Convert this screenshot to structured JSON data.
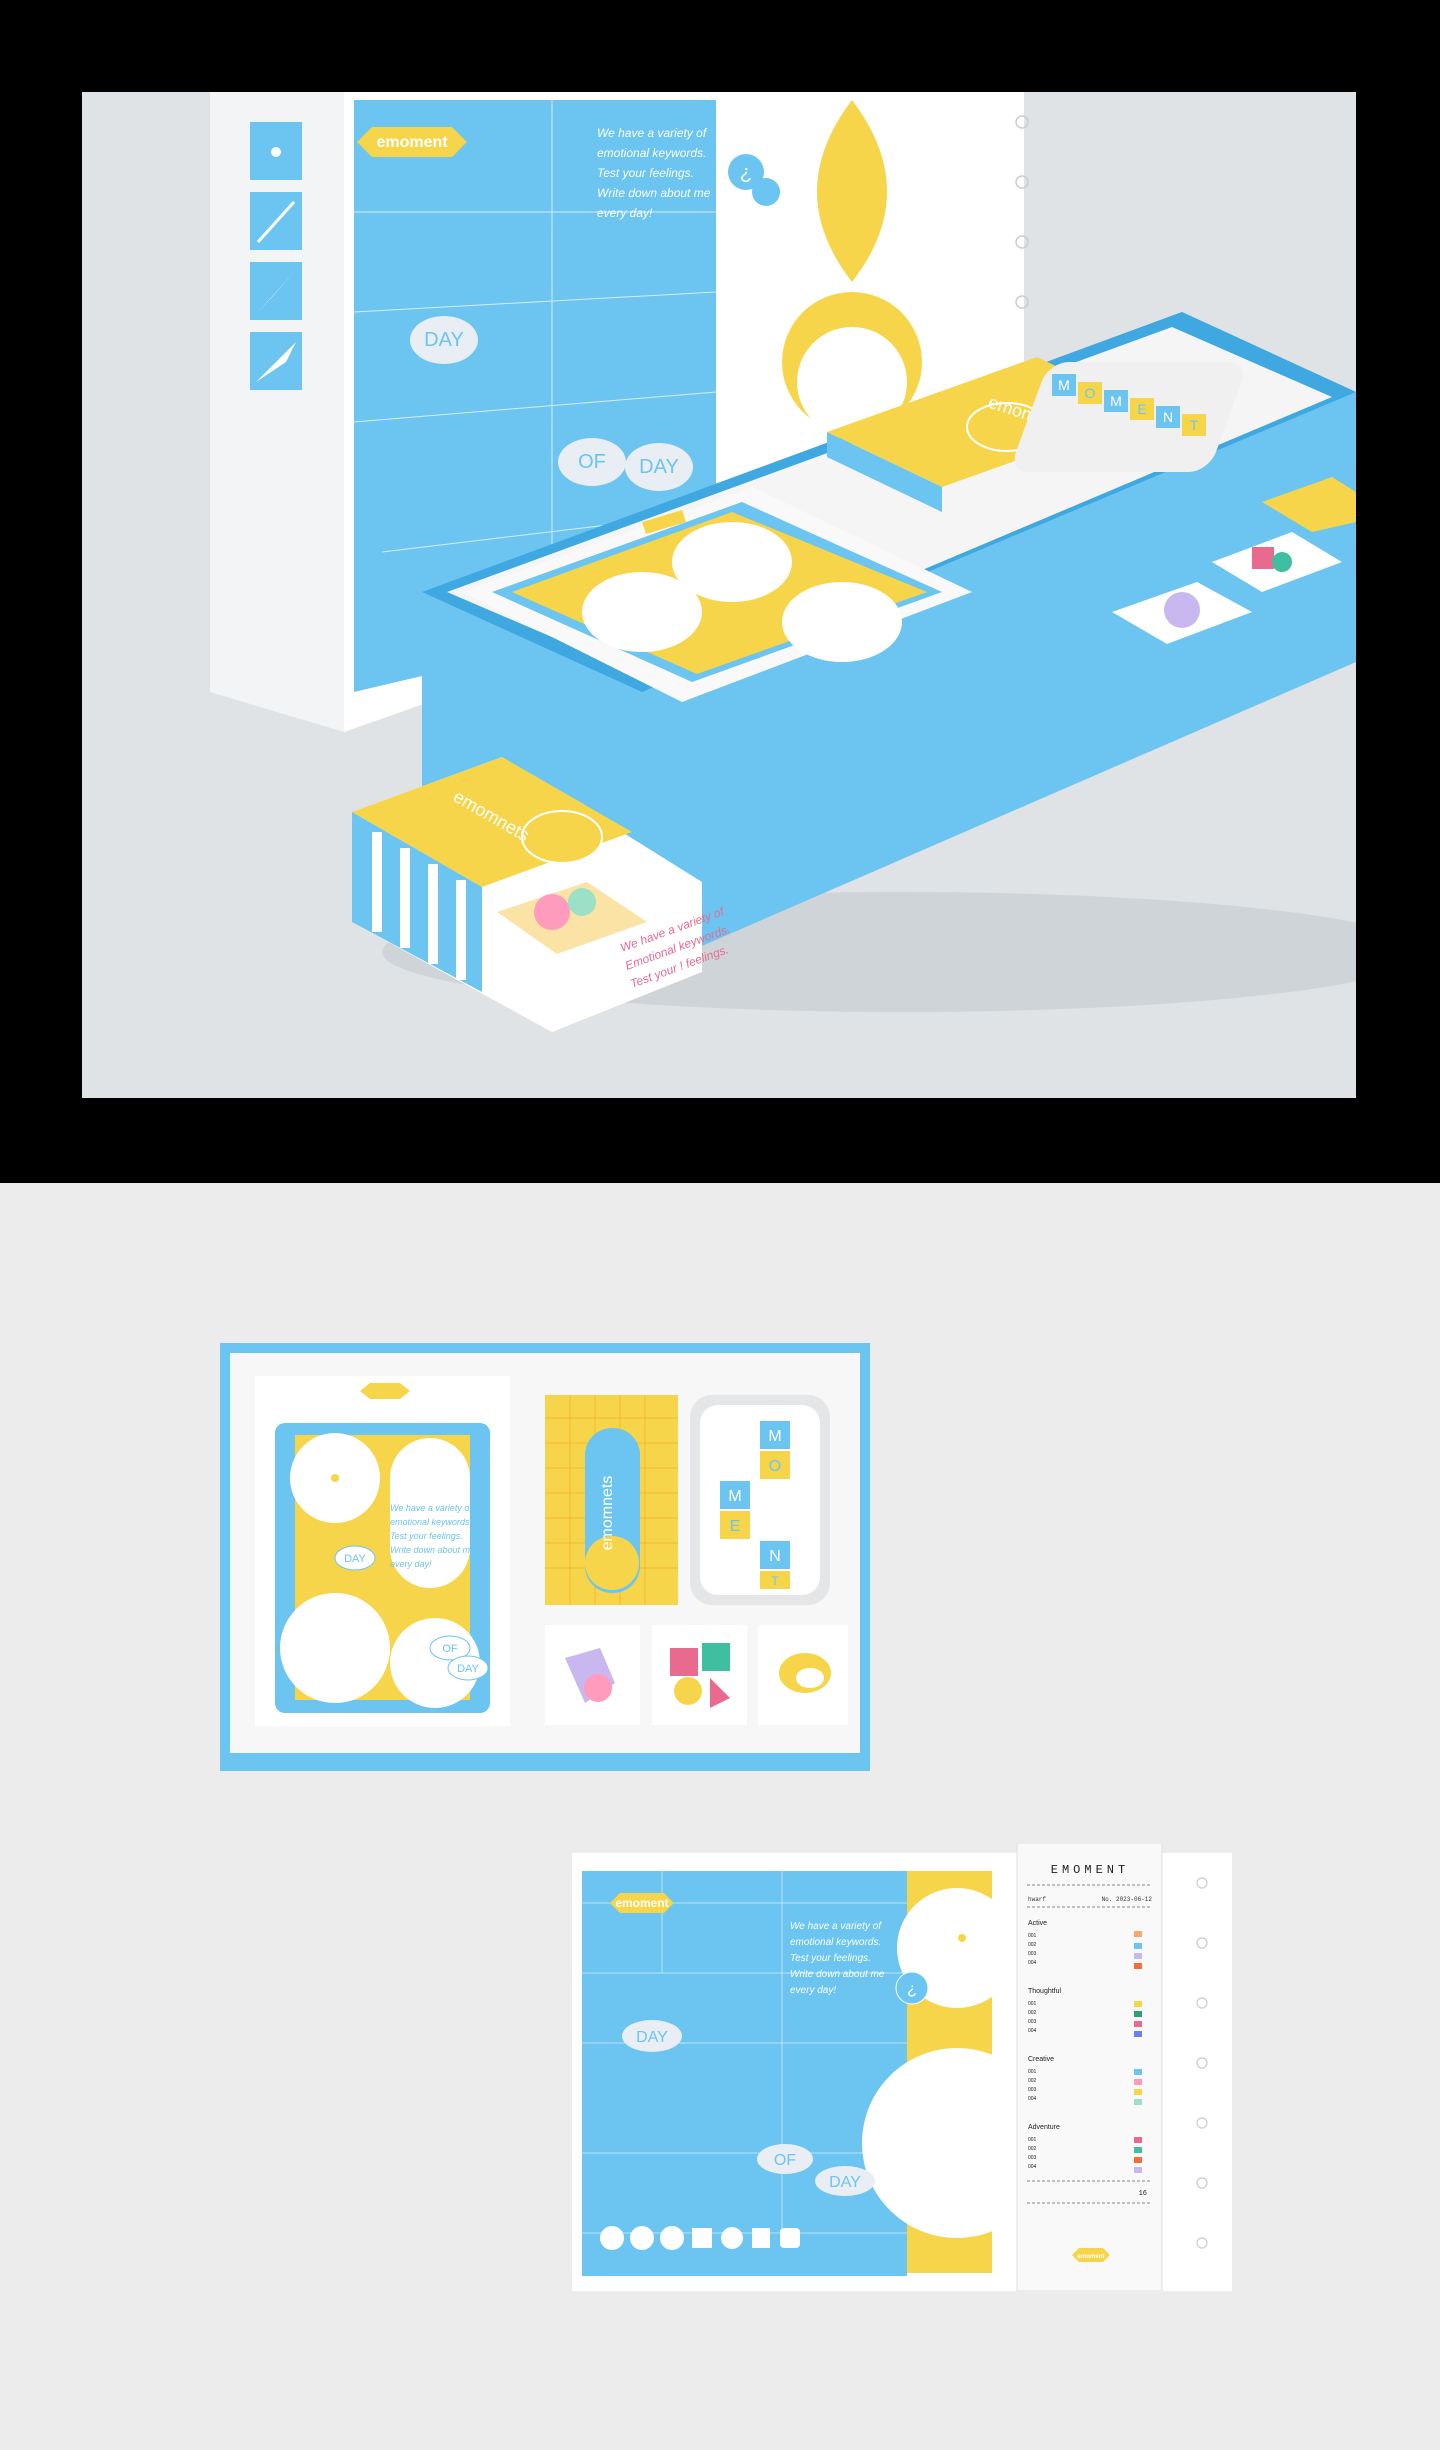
{
  "brand": {
    "name": "emoment",
    "tagline": [
      "We have a variety of",
      "emotional keywords.",
      "Test your feelings.",
      "Write down about me",
      "every day!"
    ],
    "drawer_text": [
      "We have a variety of",
      "Emotional keywords.",
      "Test your ! feelings."
    ],
    "words": {
      "day": "DAY",
      "of": "OF",
      "question": "¿"
    }
  },
  "deck": {
    "title": "emomnets"
  },
  "tin": {
    "letters": [
      "M",
      "O",
      "M",
      "E",
      "N",
      "T"
    ]
  },
  "receipt": {
    "header": "EMOMENT",
    "left_label": "hwarf",
    "number": "No. 2023-06-12",
    "sections": [
      {
        "name": "Active",
        "items": [
          "001",
          "002",
          "003",
          "004"
        ]
      },
      {
        "name": "Thoughtful",
        "items": [
          "001",
          "002",
          "003",
          "004"
        ]
      },
      {
        "name": "Creative",
        "items": [
          "001",
          "002",
          "003",
          "004"
        ]
      },
      {
        "name": "Adventure",
        "items": [
          "001",
          "002",
          "003",
          "004"
        ]
      }
    ],
    "total": "16",
    "footer_logo": "emoment"
  },
  "colors": {
    "blue": "#6cc4f0",
    "yellow": "#f7d54a",
    "white": "#ffffff",
    "pink": "#e96a8f",
    "background": "#ececec"
  }
}
